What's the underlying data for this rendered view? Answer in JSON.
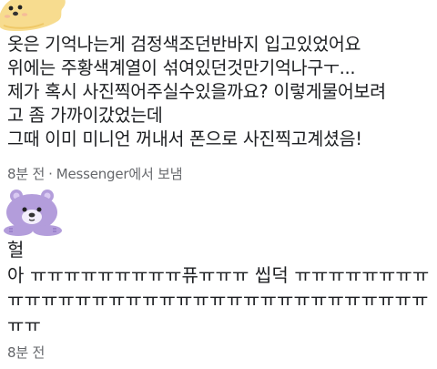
{
  "colors": {
    "background": "#ffffff",
    "text": "#1c1e21",
    "meta_text": "#65676b",
    "avatar_1": "#f7dc8f",
    "avatar_2": "#b39ddb"
  },
  "comments": [
    {
      "avatar_icon": "yellow-bear-sticker-icon",
      "lines": [
        "옷은 기억나는게 검정색조던반바지 입고있었어요",
        "위에는 주황색계열이 섞여있던것만기억나구ㅜ...",
        "제가 혹시 사진찍어주실수있을까요? 이렇게물어보려",
        "고 좀 가까이갔었는데",
        "그때 이미 미니언 꺼내서 폰으로 사진찍고계셨음!"
      ],
      "time": "8분 전",
      "separator": "·",
      "via": "Messenger에서 보냄"
    },
    {
      "avatar_icon": "purple-bear-sticker-icon",
      "lines": [
        "헐",
        "아 ㅠㅠㅠㅠㅠㅠㅠㅠㅠ퓨ㅠㅠㅠ 씹덕 ㅠㅠㅠㅠㅠㅠㅠㅠ",
        "ㅠㅠㅠㅠㅠㅠㅠㅠㅠㅠㅠㅠㅠㅠㅠㅠㅠㅠㅠㅠㅠㅠㅠㅠㅠ",
        "ㅠㅠ"
      ],
      "time": "8분 전"
    }
  ]
}
